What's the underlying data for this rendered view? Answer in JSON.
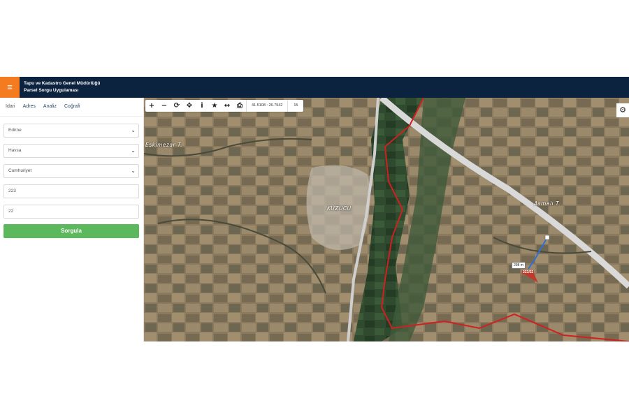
{
  "header": {
    "menu_icon": "hamburger-icon",
    "title_line1": "Tapu ve Kadastro Genel Müdürlüğü",
    "title_line2": "Parsel Sorgu Uygulaması"
  },
  "sidebar": {
    "tabs": [
      {
        "label": "İdari"
      },
      {
        "label": "Adres"
      },
      {
        "label": "Analiz"
      },
      {
        "label": "Coğrafi"
      }
    ],
    "province": "Edirne",
    "district": "Havsa",
    "neighborhood": "Cumhuriyet",
    "block": "223",
    "parcel": "22",
    "query_label": "Sorgula"
  },
  "map": {
    "coordinates": "41.5108 : 26.7942",
    "zoom": "15",
    "labels": {
      "village": "KUZUCU",
      "place1": "Eskimezar T.",
      "place2": "Asmalı T."
    },
    "distance": "298 m",
    "parcel_label": "223/22",
    "colors": {
      "header": "#0c2340",
      "accent": "#f47b20",
      "button": "#5cb85c",
      "boundary": "#d02020",
      "measure": "#2f6fd6"
    }
  }
}
